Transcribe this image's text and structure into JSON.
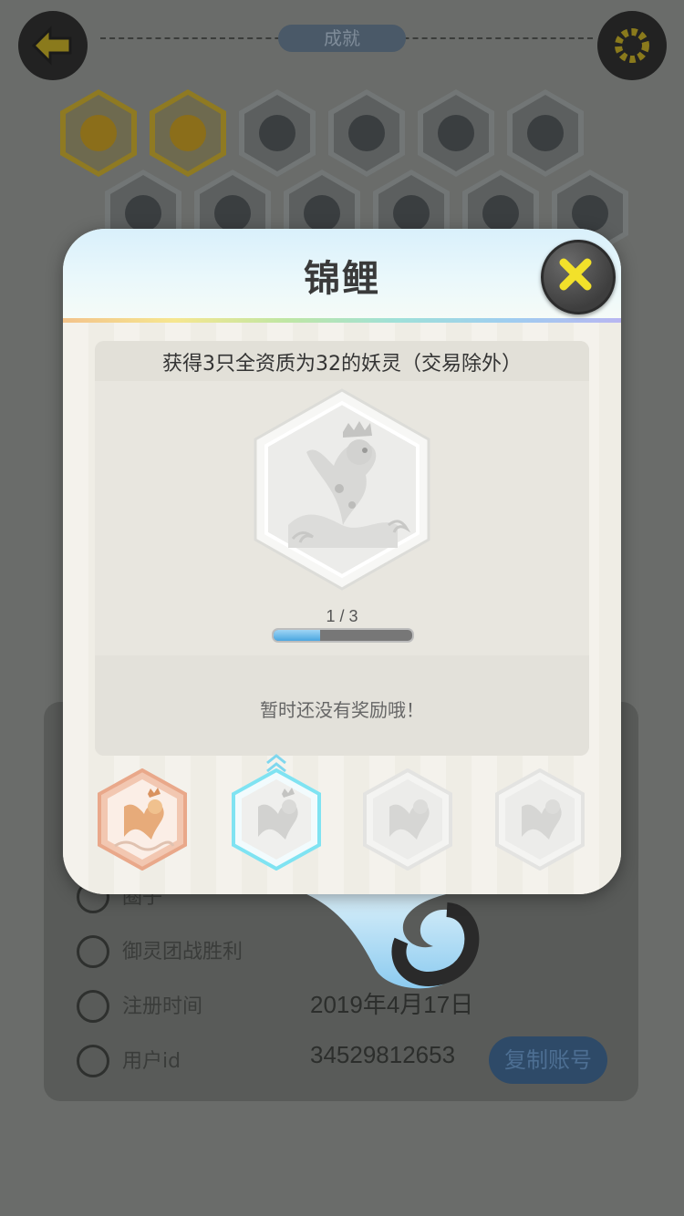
{
  "header": {
    "title": "成就"
  },
  "achievement_icons": [
    {
      "state": "unlocked"
    },
    {
      "state": "unlocked"
    },
    {
      "state": "locked"
    },
    {
      "state": "locked"
    },
    {
      "state": "locked"
    },
    {
      "state": "locked"
    },
    {
      "state": "locked"
    },
    {
      "state": "locked"
    },
    {
      "state": "locked"
    },
    {
      "state": "locked"
    },
    {
      "state": "locked"
    },
    {
      "state": "locked"
    }
  ],
  "profile": {
    "rows": [
      {
        "label": "圈子",
        "value": ""
      },
      {
        "label": "御灵团战胜利",
        "value": ""
      },
      {
        "label": "注册时间",
        "value": "2019年4月17日"
      },
      {
        "label": "用户id",
        "value": "34529812653"
      }
    ],
    "copy_button": "复制账号"
  },
  "modal": {
    "title": "锦鲤",
    "description": "获得3只全资质为32的妖灵（交易除外）",
    "progress_text": "1 / 3",
    "progress": {
      "current": 1,
      "total": 3
    },
    "reward_text": "暂时还没有奖励哦！",
    "tiers": [
      {
        "state": "completed"
      },
      {
        "state": "current"
      },
      {
        "state": "locked"
      },
      {
        "state": "locked"
      }
    ]
  },
  "colors": {
    "accent_yellow": "#f2e12a",
    "progress_blue": "#4aa6e0",
    "tier_bronze": "#f0a584",
    "tier_current": "#7fe3f2"
  }
}
